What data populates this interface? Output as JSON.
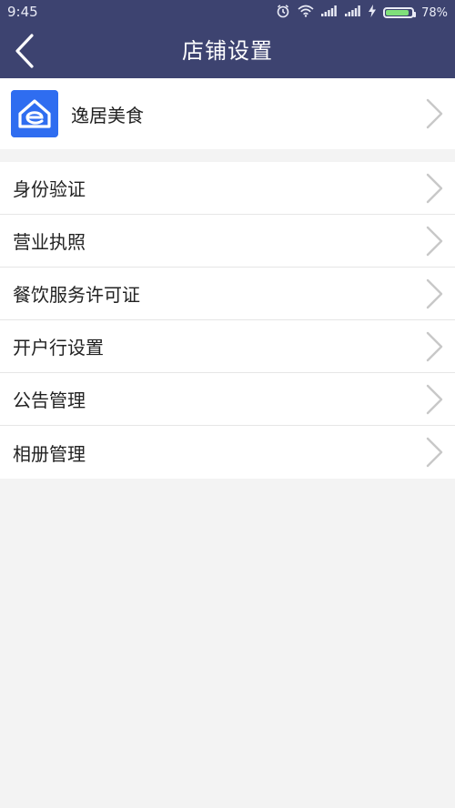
{
  "status_bar": {
    "time": "9:45",
    "battery_percent": "78%",
    "icons": [
      "alarm-icon",
      "wifi-icon",
      "signal-icon",
      "signal-icon",
      "charging-icon",
      "battery-icon"
    ]
  },
  "header": {
    "title": "店铺设置",
    "back_icon": "chevron-left-icon",
    "background_color": "#3d4370"
  },
  "store": {
    "name": "逸居美食",
    "logo_icon": "house-e-logo-icon",
    "logo_color": "#2f6df0"
  },
  "menu": {
    "items": [
      {
        "label": "身份验证"
      },
      {
        "label": "营业执照"
      },
      {
        "label": "餐饮服务许可证"
      },
      {
        "label": "开户行设置"
      },
      {
        "label": "公告管理"
      },
      {
        "label": "相册管理"
      }
    ]
  }
}
